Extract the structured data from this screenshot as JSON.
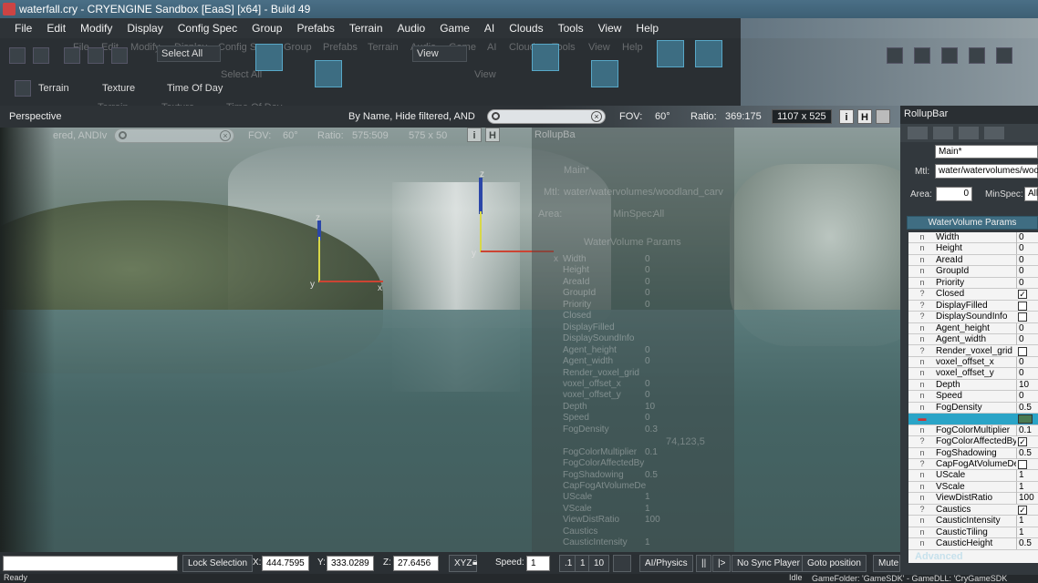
{
  "window": {
    "title": "waterfall.cry - CRYENGINE Sandbox [EaaS] [x64] - Build 49"
  },
  "menu": [
    "File",
    "Edit",
    "Modify",
    "Display",
    "Config Spec",
    "Group",
    "Prefabs",
    "Terrain",
    "Audio",
    "Game",
    "AI",
    "Clouds",
    "Tools",
    "View",
    "Help"
  ],
  "ghost_menu": [
    "File",
    "Edit",
    "Modify",
    "Display",
    "Config Spec",
    "Group",
    "Prefabs",
    "Terrain",
    "Audio",
    "Game",
    "AI",
    "Clouds",
    "Tools",
    "View",
    "Help"
  ],
  "toolbar": {
    "select_all": "Select All",
    "select_all_ghost": "Select All",
    "view": "View",
    "view_ghost": "View",
    "terrain": "Terrain",
    "texture": "Texture",
    "time_of_day": "Time Of Day",
    "terrain_ghost": "Terrain",
    "texture_ghost": "Texture",
    "time_of_day_ghost": "Time Of Day"
  },
  "viewport": {
    "name": "Perspective",
    "filter": "By Name, Hide filtered, AND",
    "filter_ghost": "ered, ANDIv",
    "fov_label": "FOV:",
    "fov_value": "60°",
    "fov_ghost_label": "FOV:",
    "fov_ghost_value": "60°",
    "ratio_label": "Ratio:",
    "ratio_value": "369:175",
    "ratio_ghost_label": "Ratio:",
    "ratio_ghost_value": "575:509",
    "resolution": "1107 x 525",
    "resolution_ghost": "575 x 50",
    "btn_i": "i",
    "btn_h": "H",
    "gizmo_labels": [
      "z",
      "x",
      "y",
      "z",
      "x",
      "y"
    ]
  },
  "rollup": {
    "title": "RollupBar",
    "ghost_title": "RollupBa",
    "name_value": "Main*",
    "name_ghost": "Main*",
    "mtl_label": "Mtl:",
    "mtl_value": "water/watervolumes/woo",
    "mtl_ghost": "water/watervolumes/woodland_carv",
    "area_label": "Area:",
    "area_value": "0",
    "minspec_label": "MinSpec:",
    "minspec_value": "All",
    "minspec_ghost": "All",
    "area_ghost_label": "Area:",
    "minspec_ghost_label": "MinSpec:",
    "params_title": "WaterVolume Params",
    "params_title_ghost": "WaterVolume Params",
    "advanced": "Advanced",
    "color_ghost_value": "74,123,5",
    "properties": [
      {
        "name": "Width",
        "value": "0",
        "icon": "num"
      },
      {
        "name": "Height",
        "value": "0",
        "icon": "num"
      },
      {
        "name": "AreaId",
        "value": "0",
        "icon": "num"
      },
      {
        "name": "GroupId",
        "value": "0",
        "icon": "num"
      },
      {
        "name": "Priority",
        "value": "0",
        "icon": "num"
      },
      {
        "name": "Closed",
        "value": "",
        "icon": "bool",
        "checked": true
      },
      {
        "name": "DisplayFilled",
        "value": "",
        "icon": "bool",
        "checked": false
      },
      {
        "name": "DisplaySoundInfo",
        "value": "",
        "icon": "bool",
        "checked": false
      },
      {
        "name": "Agent_height",
        "value": "0",
        "icon": "num"
      },
      {
        "name": "Agent_width",
        "value": "0",
        "icon": "num"
      },
      {
        "name": "Render_voxel_grid",
        "value": "",
        "icon": "bool",
        "checked": false
      },
      {
        "name": "voxel_offset_x",
        "value": "0",
        "icon": "num"
      },
      {
        "name": "voxel_offset_y",
        "value": "0",
        "icon": "num"
      },
      {
        "name": "Depth",
        "value": "10",
        "icon": "num"
      },
      {
        "name": "Speed",
        "value": "0",
        "icon": "num"
      },
      {
        "name": "FogDensity",
        "value": "0.5",
        "icon": "num"
      },
      {
        "name": "",
        "value": "",
        "icon": "color",
        "selected": true
      },
      {
        "name": "FogColorMultiplier",
        "value": "0.1",
        "icon": "num"
      },
      {
        "name": "FogColorAffectedBy",
        "value": "",
        "icon": "bool",
        "checked": true
      },
      {
        "name": "FogShadowing",
        "value": "0.5",
        "icon": "num"
      },
      {
        "name": "CapFogAtVolumeDe",
        "value": "",
        "icon": "bool",
        "checked": false
      },
      {
        "name": "UScale",
        "value": "1",
        "icon": "num"
      },
      {
        "name": "VScale",
        "value": "1",
        "icon": "num"
      },
      {
        "name": "ViewDistRatio",
        "value": "100",
        "icon": "num"
      },
      {
        "name": "Caustics",
        "value": "",
        "icon": "bool",
        "checked": true
      },
      {
        "name": "CausticIntensity",
        "value": "1",
        "icon": "num"
      },
      {
        "name": "CausticTiling",
        "value": "1",
        "icon": "num"
      },
      {
        "name": "CausticHeight",
        "value": "0.5",
        "icon": "num"
      }
    ],
    "ghost_properties": [
      {
        "name": "Width",
        "value": "0"
      },
      {
        "name": "Height",
        "value": "0"
      },
      {
        "name": "AreaId",
        "value": "0"
      },
      {
        "name": "GroupId",
        "value": "0"
      },
      {
        "name": "Priority",
        "value": "0"
      },
      {
        "name": "Closed",
        "value": ""
      },
      {
        "name": "DisplayFilled",
        "value": ""
      },
      {
        "name": "DisplaySoundInfo",
        "value": ""
      },
      {
        "name": "Agent_height",
        "value": "0"
      },
      {
        "name": "Agent_width",
        "value": "0"
      },
      {
        "name": "Render_voxel_grid",
        "value": ""
      },
      {
        "name": "voxel_offset_x",
        "value": "0"
      },
      {
        "name": "voxel_offset_y",
        "value": "0"
      },
      {
        "name": "Depth",
        "value": "10"
      },
      {
        "name": "Speed",
        "value": "0"
      },
      {
        "name": "FogDensity",
        "value": "0.3"
      },
      {
        "name": "",
        "value": ""
      },
      {
        "name": "FogColorMultiplier",
        "value": "0.1"
      },
      {
        "name": "FogColorAffectedBy",
        "value": ""
      },
      {
        "name": "FogShadowing",
        "value": "0.5"
      },
      {
        "name": "CapFogAtVolumeDe",
        "value": ""
      },
      {
        "name": "UScale",
        "value": "1"
      },
      {
        "name": "VScale",
        "value": "1"
      },
      {
        "name": "ViewDistRatio",
        "value": "100"
      },
      {
        "name": "Caustics",
        "value": ""
      },
      {
        "name": "CausticIntensity",
        "value": "1"
      }
    ]
  },
  "status": {
    "lock_selection": "Lock Selection",
    "x_label": "X:",
    "x_value": "444.7595",
    "y_label": "Y:",
    "y_value": "333.0289",
    "z_label": "Z:",
    "z_value": "27.6456",
    "xyz": "XYZ",
    "speed_label": "Speed:",
    "speed_value": "1",
    "speed_01": ".1",
    "speed_1": "1",
    "speed_10": "10",
    "ai_physics": "AI/Physics",
    "pause": "||",
    "step": "|>",
    "no_sync": "No Sync Player",
    "goto": "Goto position",
    "mute": "Mute",
    "ready": "Ready",
    "idle": "Idle",
    "game_folder": "GameFolder: 'GameSDK' - GameDLL: 'CryGameSDK"
  },
  "colors": {
    "accent": "#2aa4c7",
    "fog_color": "#4a7b52",
    "title_bar": "#4a6f86"
  }
}
